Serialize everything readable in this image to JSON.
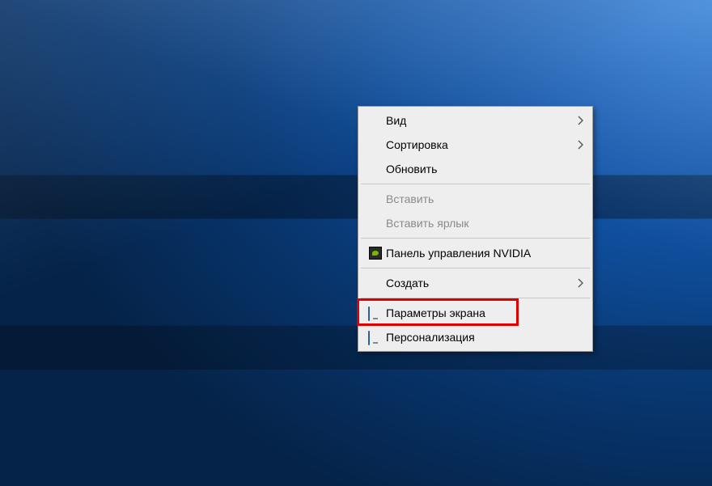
{
  "menu": {
    "view": {
      "label": "Вид",
      "hasSubmenu": true,
      "enabled": true
    },
    "sort": {
      "label": "Сортировка",
      "hasSubmenu": true,
      "enabled": true
    },
    "refresh": {
      "label": "Обновить",
      "hasSubmenu": false,
      "enabled": true
    },
    "paste": {
      "label": "Вставить",
      "hasSubmenu": false,
      "enabled": false
    },
    "pasteShortcut": {
      "label": "Вставить ярлык",
      "hasSubmenu": false,
      "enabled": false
    },
    "nvidia": {
      "label": "Панель управления NVIDIA",
      "hasSubmenu": false,
      "enabled": true
    },
    "new": {
      "label": "Создать",
      "hasSubmenu": true,
      "enabled": true
    },
    "display": {
      "label": "Параметры экрана",
      "hasSubmenu": false,
      "enabled": true
    },
    "personalize": {
      "label": "Персонализация",
      "hasSubmenu": false,
      "enabled": true
    }
  },
  "highlight": "display"
}
